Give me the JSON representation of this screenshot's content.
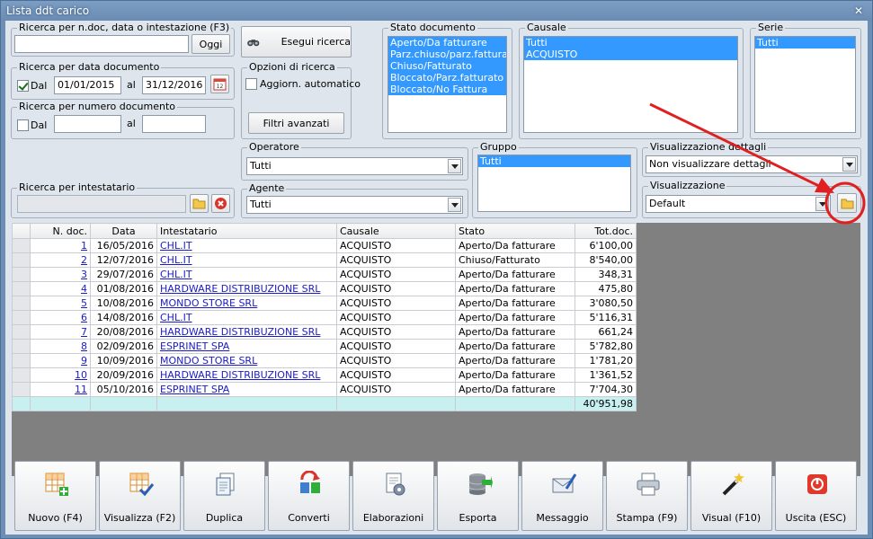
{
  "window": {
    "title": "Lista ddt carico",
    "close_glyph": "✕"
  },
  "search_ndoc": {
    "legend": "Ricerca per n.doc, data o intestazione (F3)",
    "value": "",
    "today_label": "Oggi"
  },
  "search_date": {
    "legend": "Ricerca per data documento",
    "checkbox_label": "Dal",
    "checked": true,
    "from": "01/01/2015",
    "to_label": "al",
    "to": "31/12/2016"
  },
  "search_num": {
    "legend": "Ricerca per numero documento",
    "checkbox_label": "Dal",
    "checked": false,
    "from": "",
    "to_label": "al",
    "to": ""
  },
  "search_owner": {
    "legend": "Ricerca per intestatario",
    "value": ""
  },
  "search_button": {
    "label": "Esegui ricerca",
    "icon": "binoculars-icon"
  },
  "options": {
    "legend": "Opzioni di ricerca",
    "auto_update_label": "Aggiorn. automatico",
    "advanced_filters_label": "Filtri avanzati"
  },
  "stato": {
    "legend": "Stato documento",
    "items": [
      "Aperto/Da fatturare",
      "Parz.chiuso/parz.fatturato",
      "Chiuso/Fatturato",
      "Bloccato/Parz.fatturato",
      "Bloccato/No Fattura"
    ]
  },
  "causale": {
    "legend": "Causale",
    "items": [
      "Tutti",
      "ACQUISTO"
    ]
  },
  "serie": {
    "legend": "Serie",
    "items": [
      "Tutti"
    ]
  },
  "operatore": {
    "legend": "Operatore",
    "value": "Tutti"
  },
  "agente": {
    "legend": "Agente",
    "value": "Tutti"
  },
  "gruppo": {
    "legend": "Gruppo",
    "items": [
      "Tutti"
    ]
  },
  "vis_dettagli": {
    "legend": "Visualizzazione dettagli",
    "value": "Non visualizzare dettagli"
  },
  "visualizzazione": {
    "legend": "Visualizzazione",
    "value": "Default"
  },
  "grid": {
    "columns": [
      "N. doc.",
      "Data",
      "Intestatario",
      "Causale",
      "Stato",
      "Tot.doc."
    ],
    "rows": [
      [
        "1",
        "16/05/2016",
        "CHL.IT",
        "ACQUISTO",
        "Aperto/Da fatturare",
        "6'100,00"
      ],
      [
        "2",
        "12/07/2016",
        "CHL.IT",
        "ACQUISTO",
        "Chiuso/Fatturato",
        "8'540,00"
      ],
      [
        "3",
        "29/07/2016",
        "CHL.IT",
        "ACQUISTO",
        "Aperto/Da fatturare",
        "348,31"
      ],
      [
        "4",
        "01/08/2016",
        "HARDWARE DISTRIBUZIONE SRL",
        "ACQUISTO",
        "Aperto/Da fatturare",
        "475,80"
      ],
      [
        "5",
        "10/08/2016",
        "MONDO STORE SRL",
        "ACQUISTO",
        "Aperto/Da fatturare",
        "3'080,50"
      ],
      [
        "6",
        "14/08/2016",
        "CHL.IT",
        "ACQUISTO",
        "Aperto/Da fatturare",
        "5'116,31"
      ],
      [
        "7",
        "20/08/2016",
        "HARDWARE DISTRIBUZIONE SRL",
        "ACQUISTO",
        "Aperto/Da fatturare",
        "661,24"
      ],
      [
        "8",
        "02/09/2016",
        "ESPRINET SPA",
        "ACQUISTO",
        "Aperto/Da fatturare",
        "5'782,80"
      ],
      [
        "9",
        "10/09/2016",
        "MONDO STORE SRL",
        "ACQUISTO",
        "Aperto/Da fatturare",
        "1'781,20"
      ],
      [
        "10",
        "20/09/2016",
        "HARDWARE DISTRIBUZIONE SRL",
        "ACQUISTO",
        "Aperto/Da fatturare",
        "1'361,52"
      ],
      [
        "11",
        "05/10/2016",
        "ESPRINET SPA",
        "ACQUISTO",
        "Aperto/Da fatturare",
        "7'704,30"
      ]
    ],
    "total": "40'951,98"
  },
  "toolbar": [
    {
      "label": "Nuovo (F4)",
      "icon": "new-grid-icon"
    },
    {
      "label": "Visualizza (F2)",
      "icon": "view-grid-icon"
    },
    {
      "label": "Duplica",
      "icon": "duplicate-icon"
    },
    {
      "label": "Converti",
      "icon": "convert-icon"
    },
    {
      "label": "Elaborazioni",
      "icon": "process-icon"
    },
    {
      "label": "Esporta",
      "icon": "database-export-icon"
    },
    {
      "label": "Messaggio",
      "icon": "envelope-icon"
    },
    {
      "label": "Stampa (F9)",
      "icon": "printer-icon"
    },
    {
      "label": "Visual (F10)",
      "icon": "magic-wand-icon"
    },
    {
      "label": "Uscita (ESC)",
      "icon": "power-icon"
    }
  ],
  "colors": {
    "window_frame": "#6d8fb6",
    "client_bg": "#dfe5ec",
    "list_selection": "#3399ff",
    "annotation": "#e02020"
  }
}
